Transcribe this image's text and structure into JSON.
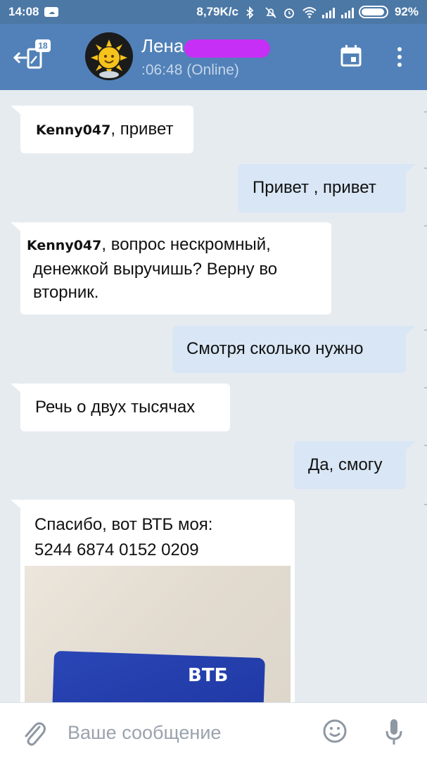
{
  "status_bar": {
    "time": "14:08",
    "speed": "8,79K/c",
    "battery": "92%"
  },
  "header": {
    "badge_count": "18",
    "contact_name": "Лена",
    "status": ":06:48 (Online)"
  },
  "messages": [
    {
      "direction": "in",
      "mention": "Kenny047",
      "text": ", привет"
    },
    {
      "direction": "out",
      "text": "Привет , привет"
    },
    {
      "direction": "in",
      "mention": "Kenny047",
      "line1": ", вопрос нескромный,",
      "line2": "денежкой выручишь? Верну во",
      "line3": "вторник."
    },
    {
      "direction": "out",
      "text": "Смотря сколько нужно"
    },
    {
      "direction": "in",
      "text": "Речь о двух тысячах"
    },
    {
      "direction": "out",
      "text": "Да, смогу"
    },
    {
      "direction": "in",
      "line1": "Спасибо, вот ВТБ моя:",
      "line2": "5244 6874 0152 0209",
      "photo_logo": "ВТБ"
    }
  ],
  "composer": {
    "placeholder": "Ваше сообщение"
  },
  "colors": {
    "header": "#5181b8",
    "status_bar": "#4c78a6",
    "outgoing_bubble": "#d8e6f5",
    "incoming_bubble": "#ffffff",
    "chat_background": "#e6ebf0",
    "name_mask": "#c62ff5"
  },
  "icons": [
    "back-arrow-icon",
    "calendar-icon",
    "more-vertical-icon",
    "paperclip-icon",
    "emoji-icon",
    "microphone-icon"
  ]
}
